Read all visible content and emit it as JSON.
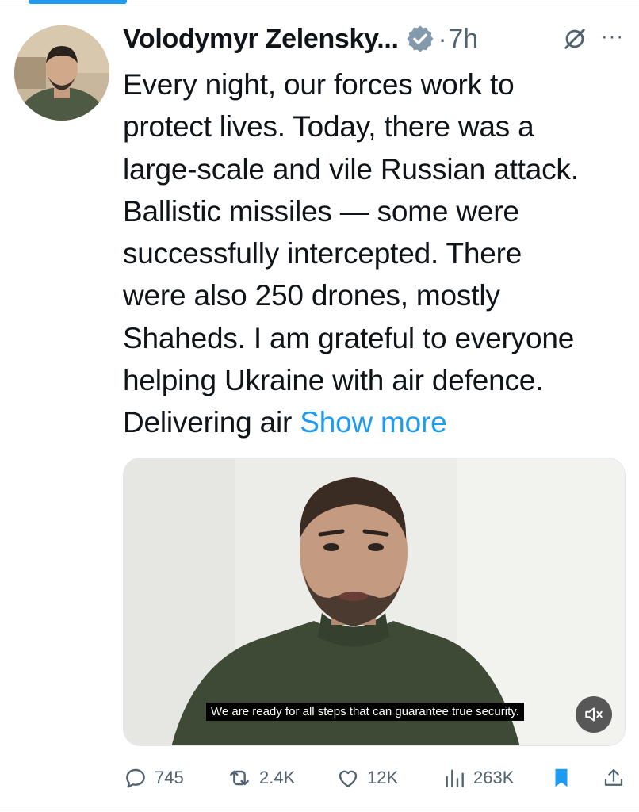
{
  "post": {
    "author_name": "Volodymyr Zelensky...",
    "dot": "·",
    "time": "7h",
    "more_menu": "···",
    "text_lines": [
      "Every night, our forces work to",
      "protect lives. Today, there was a",
      "large-scale and vile Russian attack.",
      "Ballistic missiles — some were",
      "successfully intercepted. There",
      "were also 250 drones, mostly",
      "Shaheds. I am grateful to everyone",
      "helping Ukraine with air defence."
    ],
    "last_line_text": "Delivering air",
    "show_more": "Show more"
  },
  "media": {
    "caption": "We are ready for all steps that can guarantee true security.",
    "mute_icon": "speaker-muted-icon"
  },
  "actions": {
    "replies": "745",
    "reposts": "2.4K",
    "likes": "12K",
    "views": "263K",
    "bookmarked": true
  },
  "colors": {
    "accent": "#1d9bf0",
    "muted_text": "#536471",
    "text": "#0f1419"
  }
}
